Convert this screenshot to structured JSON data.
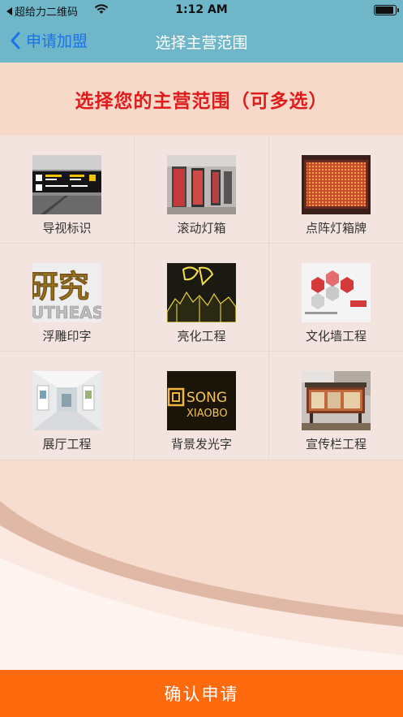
{
  "status_bar": {
    "back_app": "超给力二维码",
    "time": "1:12 AM"
  },
  "nav": {
    "back_label": "申请加盟",
    "title": "选择主营范围"
  },
  "banner": {
    "headline": "选择您的主营范围（可多选）"
  },
  "categories": [
    {
      "label": "导视标识",
      "image": "signage-photo"
    },
    {
      "label": "滚动灯箱",
      "image": "scrolling-lightbox-photo"
    },
    {
      "label": "点阵灯箱牌",
      "image": "dot-matrix-sign-photo"
    },
    {
      "label": "浮雕印字",
      "image": "relief-letters-photo"
    },
    {
      "label": "亮化工程",
      "image": "lighting-project-photo"
    },
    {
      "label": "文化墙工程",
      "image": "culture-wall-photo"
    },
    {
      "label": "展厅工程",
      "image": "exhibition-hall-photo"
    },
    {
      "label": "背景发光字",
      "image": "backlit-letters-photo"
    },
    {
      "label": "宣传栏工程",
      "image": "bulletin-board-photo"
    }
  ],
  "thumb_text": {
    "relief": "研究",
    "relief_sub": "UTHEAST",
    "backlit": "SONG",
    "backlit_sub": "XIAOBO"
  },
  "confirm_button": "确认申请",
  "colors": {
    "nav_bg": "#6fb6c9",
    "banner_bg": "#f7d9ca",
    "headline": "#e01b1b",
    "confirm_bg": "#ff6a0f",
    "back_link": "#1a73e8"
  }
}
